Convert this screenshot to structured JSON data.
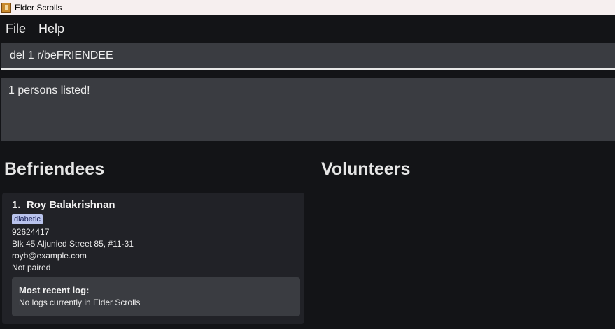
{
  "window": {
    "title": "Elder Scrolls",
    "icon": "app-scroll-icon"
  },
  "menu": {
    "items": [
      "File",
      "Help"
    ]
  },
  "command": {
    "value": "del 1 r/beFRIENDEE"
  },
  "result": {
    "text": "1 persons listed!"
  },
  "befriendees": {
    "title": "Befriendees",
    "persons": [
      {
        "index": "1.",
        "name": "Roy Balakrishnan",
        "tags": [
          "diabetic"
        ],
        "phone": "92624417",
        "address": "Blk 45 Aljunied Street 85, #11-31",
        "email": "royb@example.com",
        "pairing": "Not paired",
        "log_title": "Most recent log:",
        "log_text": "No logs currently in Elder Scrolls"
      }
    ]
  },
  "volunteers": {
    "title": "Volunteers",
    "persons": []
  },
  "colors": {
    "background": "#131417",
    "panel": "#3a3c41",
    "card": "#212227",
    "tag_bg": "#b9c3ec",
    "tag_text": "#1a2258"
  }
}
